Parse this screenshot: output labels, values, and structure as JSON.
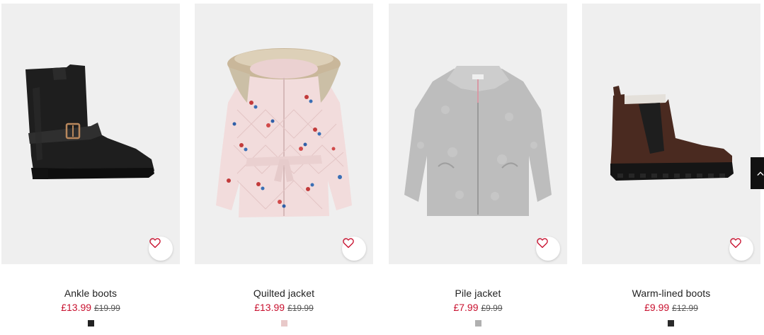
{
  "products": [
    {
      "name": "Ankle boots",
      "price": "£13.99",
      "old_price": "£19.99",
      "swatch_color": "#222222",
      "image": "black-ankle-boot-with-buckle",
      "favorite_icon": "heart-outline-icon"
    },
    {
      "name": "Quilted jacket",
      "price": "£13.99",
      "old_price": "£19.99",
      "swatch_color": "#e8c9c9",
      "image": "pink-floral-quilted-jacket-with-fur-hood",
      "favorite_icon": "heart-outline-icon"
    },
    {
      "name": "Pile jacket",
      "price": "£7.99",
      "old_price": "£9.99",
      "swatch_color": "#b0b0b0",
      "image": "grey-pile-fleece-jacket",
      "favorite_icon": "heart-outline-icon"
    },
    {
      "name": "Warm-lined boots",
      "price": "£9.99",
      "old_price": "£12.99",
      "swatch_color": "#2a2a2a",
      "image": "brown-chelsea-boot",
      "favorite_icon": "heart-outline-icon"
    }
  ],
  "colors": {
    "sale_price": "#c8102e",
    "favorite_heart": "#c8102e",
    "image_background": "#efefef"
  },
  "scroll_top_icon": "chevron-up-icon"
}
